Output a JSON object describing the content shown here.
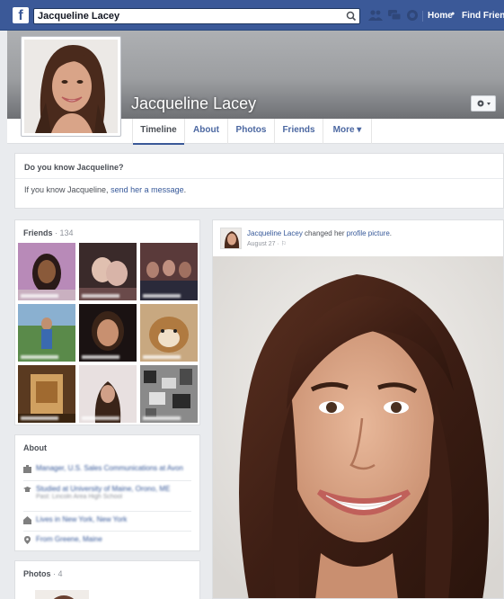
{
  "topbar": {
    "logo": "f",
    "search_value": "Jacqueline Lacey",
    "home_label": "Home",
    "find_friends_label": "Find Friends",
    "icons": [
      "search-icon",
      "friend-requests-icon",
      "messages-icon",
      "notifications-icon"
    ]
  },
  "profile": {
    "name": "Jacqueline Lacey",
    "tabs": [
      {
        "label": "Timeline"
      },
      {
        "label": "About"
      },
      {
        "label": "Photos"
      },
      {
        "label": "Friends"
      },
      {
        "label": "More ▾"
      }
    ]
  },
  "know": {
    "title": "Do you know Jacqueline?",
    "text_prefix": "If you know Jacqueline, ",
    "link": "send her a message",
    "suffix": "."
  },
  "friends": {
    "title": "Friends",
    "count": "· 134"
  },
  "about": {
    "title": "About",
    "items": [
      {
        "icon": "briefcase-icon",
        "text": "Manager, U.S. Sales Communications at Avon",
        "sub": ""
      },
      {
        "icon": "graduation-cap-icon",
        "text": "Studied at University of Maine, Orono, ME",
        "sub": "Past: Lincoln Area High School"
      },
      {
        "icon": "home-icon",
        "text": "Lives in New York, New York",
        "sub": ""
      },
      {
        "icon": "location-pin-icon",
        "text": "From Greene, Maine",
        "sub": ""
      }
    ]
  },
  "photos": {
    "title": "Photos",
    "count": "· 4"
  },
  "post": {
    "author": "Jacqueline Lacey",
    "action": " changed her ",
    "object": "profile picture",
    "suffix": ".",
    "date": "August 27 · ⚐"
  },
  "colors": {
    "brand": "#3b5998",
    "link": "#365899",
    "page_bg": "#e9ebee"
  }
}
